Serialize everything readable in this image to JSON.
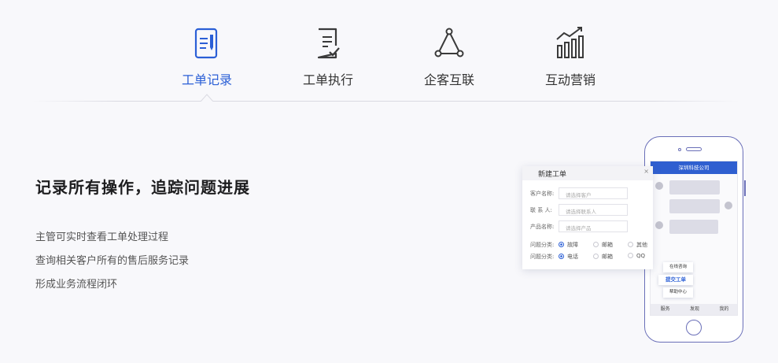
{
  "tabs": [
    {
      "label": "工单记录",
      "icon": "document-edit-icon",
      "active": true
    },
    {
      "label": "工单执行",
      "icon": "checklist-icon",
      "active": false
    },
    {
      "label": "企客互联",
      "icon": "network-triangle-icon",
      "active": false
    },
    {
      "label": "互动营销",
      "icon": "bar-growth-icon",
      "active": false
    }
  ],
  "colors": {
    "accent": "#2b5fd6",
    "phone_outline": "#6a6fb8",
    "text_dark": "#1d1d1f",
    "text_body": "#555555"
  },
  "content": {
    "headline": "记录所有操作，追踪问题进展",
    "features": [
      "主管可实时查看工单处理过程",
      "查询相关客户所有的售后服务记录",
      "形成业务流程闭环"
    ]
  },
  "form": {
    "title": "新建工单",
    "close": "×",
    "fields": [
      {
        "label": "客户名称:",
        "placeholder": "请选择客户"
      },
      {
        "label": "联 系 人:",
        "placeholder": "请选择联系人"
      },
      {
        "label": "产品名称:",
        "placeholder": "请选择产品"
      }
    ],
    "radio_groups": [
      {
        "label": "问题分类:",
        "options": [
          "故障",
          "邮箱",
          "其他"
        ],
        "selected": "故障"
      },
      {
        "label": "问题分类:",
        "options": [
          "电话",
          "邮箱",
          "QQ"
        ],
        "selected": "电话"
      }
    ]
  },
  "phone": {
    "header": "深圳科技公司",
    "menu": [
      "在线咨询",
      "提交工单",
      "帮助中心"
    ],
    "nav": [
      "服务",
      "发现",
      "我的"
    ]
  }
}
